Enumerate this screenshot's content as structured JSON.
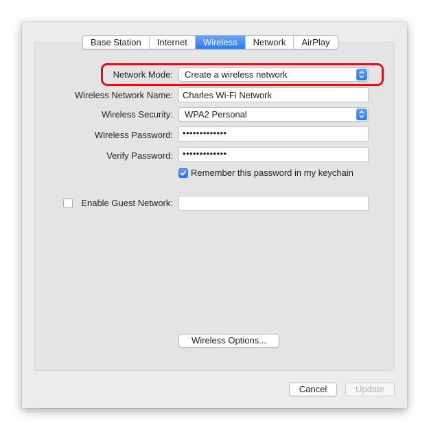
{
  "tabs": [
    {
      "label": "Base Station",
      "active": false
    },
    {
      "label": "Internet",
      "active": false
    },
    {
      "label": "Wireless",
      "active": true
    },
    {
      "label": "Network",
      "active": false
    },
    {
      "label": "AirPlay",
      "active": false
    }
  ],
  "form": {
    "network_mode": {
      "label": "Network Mode:",
      "value": "Create a wireless network"
    },
    "network_name": {
      "label": "Wireless Network Name:",
      "value": "Charles Wi-Fi Network"
    },
    "security": {
      "label": "Wireless Security:",
      "value": "WPA2 Personal"
    },
    "password": {
      "label": "Wireless Password:",
      "value": "•••••••••••••"
    },
    "verify": {
      "label": "Verify Password:",
      "value": "•••••••••••••"
    },
    "remember": {
      "label": "Remember this password in my keychain",
      "checked": true
    },
    "guest": {
      "label": "Enable Guest Network:",
      "checked": false,
      "value": ""
    }
  },
  "buttons": {
    "wireless_options": "Wireless Options...",
    "cancel": "Cancel",
    "update": "Update"
  },
  "colors": {
    "accent": "#2d7bf0",
    "highlight": "#d4161f"
  },
  "icons": {
    "stepper": "up-down-chevron-icon",
    "check": "checkmark-icon"
  }
}
